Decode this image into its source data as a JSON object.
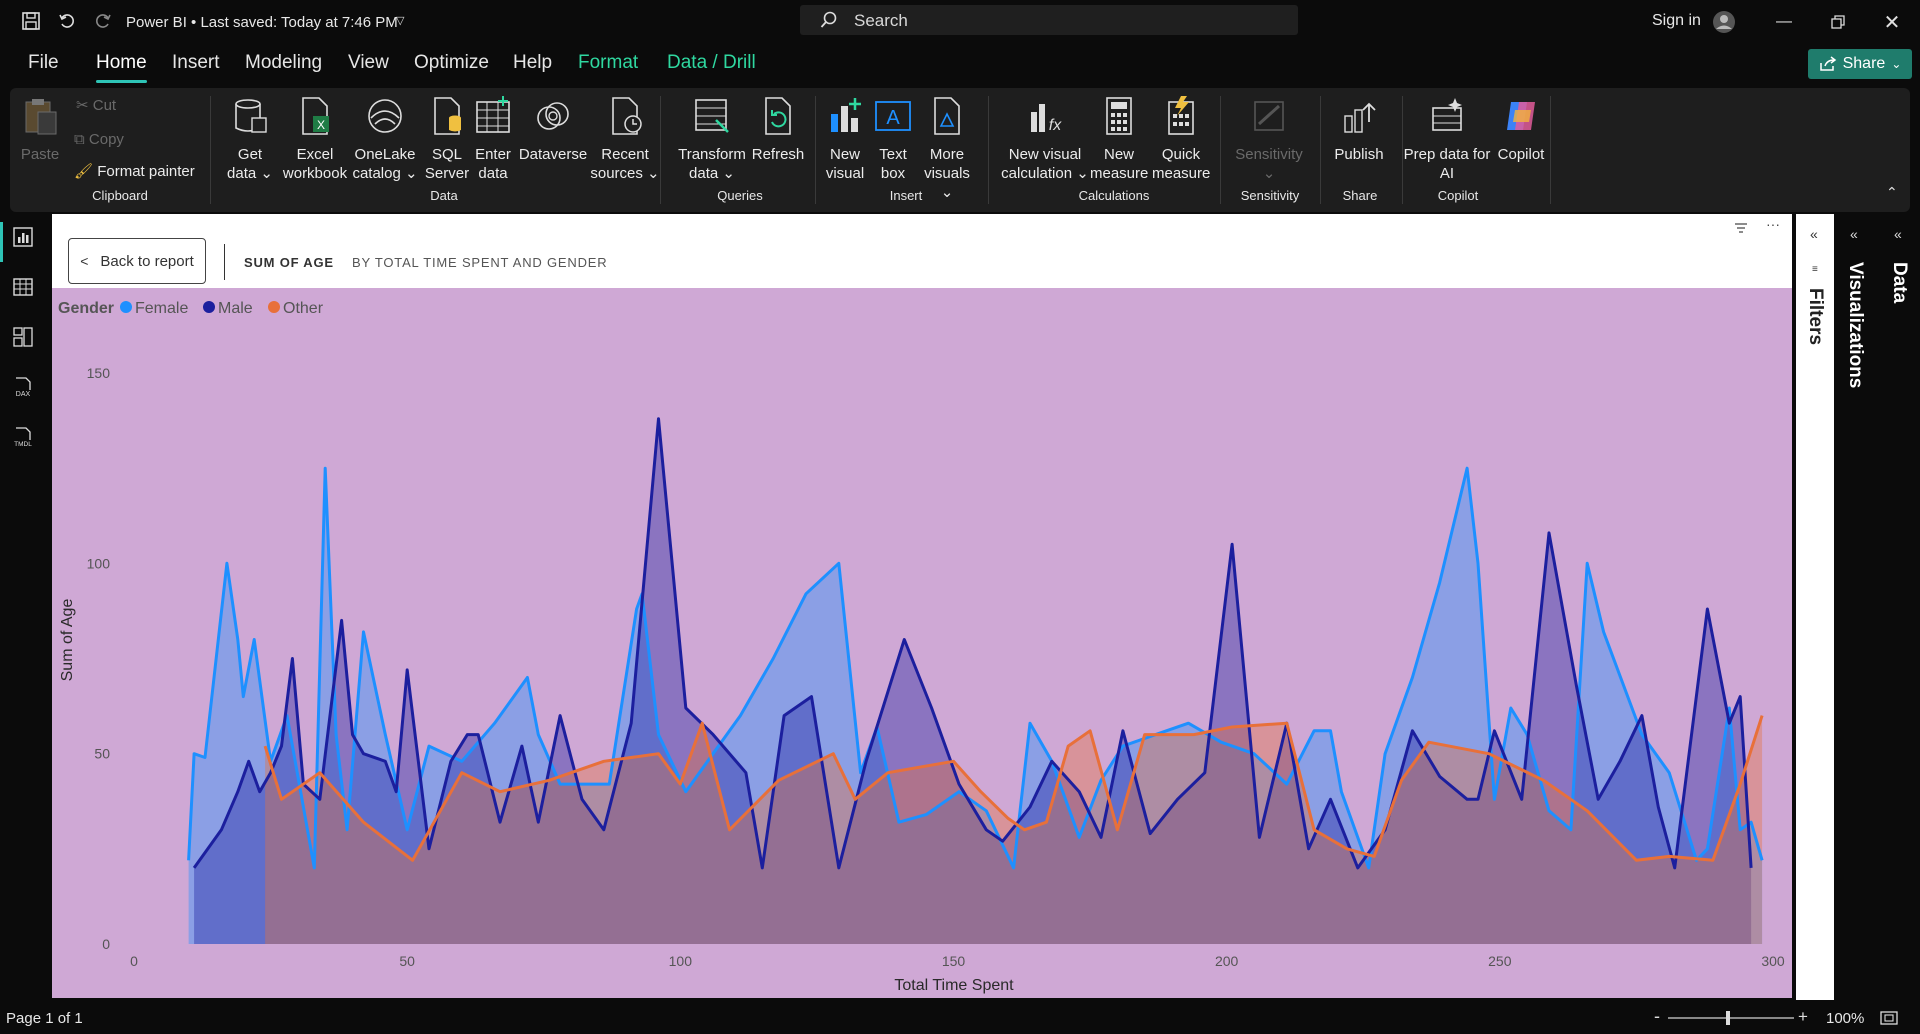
{
  "app": {
    "title": "Power BI • Last saved: Today at 7:46 PM",
    "search_label": "Search",
    "signin_label": "Sign in"
  },
  "menu": {
    "items": [
      "File",
      "Home",
      "Insert",
      "Modeling",
      "View",
      "Optimize",
      "Help",
      "Format",
      "Data / Drill"
    ],
    "share_label": "Share"
  },
  "ribbon": {
    "clipboard": {
      "paste": "Paste",
      "cut": "Cut",
      "copy": "Copy",
      "format_painter": "Format painter",
      "group": "Clipboard"
    },
    "data": {
      "get_data": [
        "Get",
        "data"
      ],
      "excel": [
        "Excel",
        "workbook"
      ],
      "onelake": [
        "OneLake",
        "catalog"
      ],
      "sql": [
        "SQL",
        "Server"
      ],
      "enter": [
        "Enter",
        "data"
      ],
      "dataverse": [
        "Dataverse",
        ""
      ],
      "recent": [
        "Recent",
        "sources"
      ],
      "group": "Data"
    },
    "queries": {
      "transform": [
        "Transform",
        "data"
      ],
      "refresh": [
        "Refresh",
        ""
      ],
      "group": "Queries"
    },
    "insert": {
      "new_visual": [
        "New",
        "visual"
      ],
      "text_box": [
        "Text",
        "box"
      ],
      "more_visuals": [
        "More",
        "visuals"
      ],
      "group": "Insert"
    },
    "calculations": {
      "new_visual_calc": [
        "New visual",
        "calculation"
      ],
      "new_measure": [
        "New",
        "measure"
      ],
      "quick_measure": [
        "Quick",
        "measure"
      ],
      "group": "Calculations"
    },
    "sensitivity": {
      "label": "Sensitivity",
      "group": "Sensitivity"
    },
    "share": {
      "publish": "Publish",
      "group": "Share"
    },
    "copilot": {
      "prep": [
        "Prep data for",
        "AI"
      ],
      "copilot": "Copilot",
      "group": "Copilot"
    }
  },
  "drill": {
    "back_label": "Back to report",
    "measure_label": "SUM OF AGE",
    "by_label": "BY TOTAL TIME SPENT AND GENDER"
  },
  "panes": {
    "filters": "Filters",
    "visualizations": "Visualizations",
    "data": "Data"
  },
  "status": {
    "page": "Page 1 of 1",
    "zoom": "100%"
  },
  "colors": {
    "female": "#1e90ff",
    "male": "#1c1f9e",
    "other": "#e8703a",
    "plot_bg": "#cfa8d5",
    "accent": "#2ec4b6"
  },
  "chart_data": {
    "type": "area",
    "legend_title": "Gender",
    "legend_position": "top-left",
    "xlabel": "Total Time Spent",
    "ylabel": "Sum of Age",
    "xlim": [
      0,
      300
    ],
    "ylim": [
      0,
      150
    ],
    "x_ticks": [
      "0",
      "50",
      "100",
      "150",
      "200",
      "250",
      "300"
    ],
    "y_ticks": [
      "0",
      "50",
      "100",
      "150"
    ],
    "series": [
      {
        "name": "Female",
        "color": "#1e90ff",
        "x": [
          10,
          11,
          13,
          17,
          19,
          20,
          22,
          25,
          28,
          33,
          35,
          37,
          39,
          42,
          46,
          50,
          54,
          60,
          66,
          72,
          74,
          78,
          82,
          87,
          92,
          93,
          96,
          101,
          105,
          111,
          117,
          123,
          129,
          133,
          136,
          140,
          145,
          151,
          156,
          161,
          164,
          168,
          173,
          177,
          181,
          187,
          193,
          199,
          205,
          211,
          216,
          219,
          221,
          226,
          229,
          234,
          239,
          244,
          246,
          249,
          252,
          255,
          259,
          263,
          266,
          269,
          276,
          281,
          286,
          288,
          292,
          294,
          296,
          298
        ],
        "y": [
          22,
          50,
          49,
          100,
          80,
          65,
          80,
          48,
          60,
          20,
          125,
          55,
          30,
          82,
          55,
          30,
          52,
          48,
          58,
          70,
          55,
          42,
          42,
          42,
          88,
          92,
          55,
          40,
          48,
          60,
          75,
          92,
          100,
          45,
          57,
          32,
          34,
          40,
          35,
          20,
          58,
          48,
          28,
          43,
          52,
          55,
          58,
          53,
          50,
          42,
          56,
          56,
          40,
          20,
          50,
          70,
          95,
          125,
          100,
          38,
          62,
          55,
          35,
          30,
          100,
          82,
          55,
          45,
          22,
          25,
          62,
          30,
          32,
          22
        ]
      },
      {
        "name": "Male",
        "color": "#1c1f9e",
        "x": [
          11,
          14,
          16,
          19,
          21,
          23,
          25,
          27,
          29,
          31,
          34,
          38,
          40,
          42,
          46,
          48,
          50,
          54,
          58,
          61,
          63,
          67,
          71,
          74,
          78,
          82,
          86,
          91,
          96,
          101,
          106,
          112,
          115,
          119,
          124,
          129,
          134,
          141,
          146,
          151,
          156,
          159,
          164,
          168,
          173,
          177,
          181,
          186,
          191,
          196,
          201,
          206,
          211,
          215,
          219,
          224,
          229,
          234,
          239,
          244,
          246,
          249,
          254,
          259,
          264,
          268,
          272,
          276,
          279,
          282,
          288,
          292,
          294,
          296
        ],
        "y": [
          20,
          26,
          30,
          40,
          48,
          40,
          45,
          52,
          75,
          42,
          38,
          85,
          55,
          50,
          48,
          40,
          72,
          25,
          48,
          55,
          55,
          32,
          52,
          32,
          60,
          38,
          30,
          58,
          138,
          62,
          55,
          45,
          20,
          60,
          65,
          20,
          48,
          80,
          62,
          42,
          30,
          27,
          36,
          48,
          40,
          28,
          56,
          29,
          38,
          45,
          105,
          28,
          58,
          25,
          38,
          20,
          30,
          56,
          44,
          38,
          38,
          56,
          38,
          108,
          68,
          38,
          48,
          60,
          36,
          20,
          88,
          58,
          65,
          20
        ]
      },
      {
        "name": "Other",
        "color": "#e8703a",
        "x": [
          24,
          27,
          34,
          42,
          51,
          60,
          67,
          76,
          86,
          96,
          100,
          104,
          109,
          118,
          128,
          132,
          138,
          150,
          155,
          160,
          163,
          167,
          171,
          175,
          180,
          185,
          194,
          201,
          211,
          216,
          222,
          227,
          232,
          237,
          248,
          258,
          266,
          275,
          281,
          289,
          294,
          298
        ],
        "y": [
          52,
          38,
          45,
          32,
          22,
          45,
          40,
          43,
          48,
          50,
          42,
          58,
          30,
          43,
          50,
          38,
          45,
          48,
          40,
          33,
          30,
          32,
          52,
          56,
          30,
          55,
          55,
          57,
          58,
          30,
          25,
          23,
          43,
          53,
          50,
          43,
          35,
          22,
          23,
          22,
          42,
          60
        ]
      }
    ]
  }
}
